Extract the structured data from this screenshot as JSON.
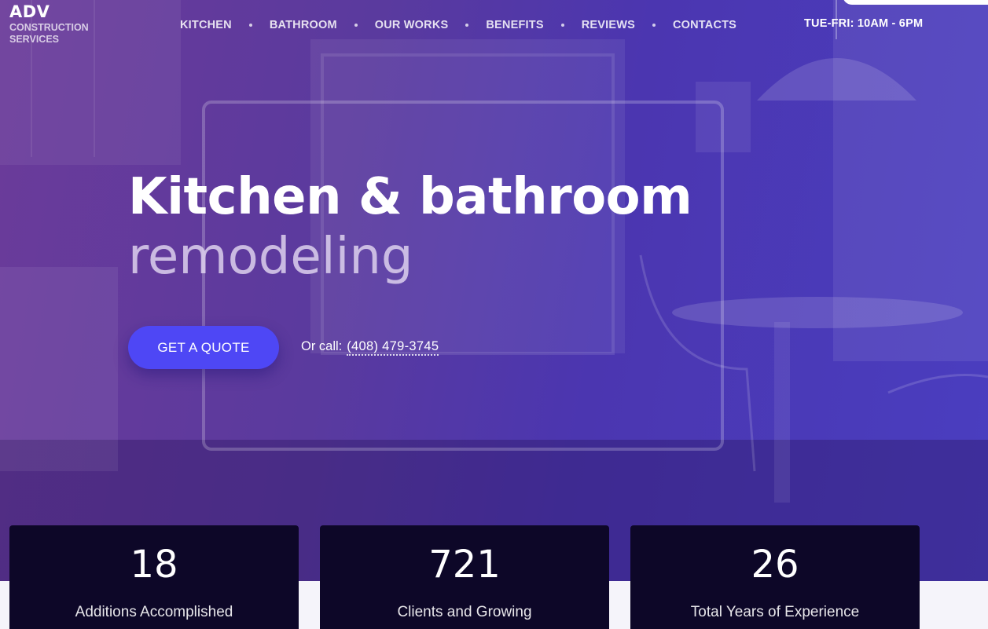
{
  "brand": {
    "name": "ADV",
    "tagline": "CONSTRUCTION SERVICES"
  },
  "nav": {
    "items": [
      {
        "label": "KITCHEN"
      },
      {
        "label": "BATHROOM"
      },
      {
        "label": "OUR WORKS"
      },
      {
        "label": "BENEFITS"
      },
      {
        "label": "REVIEWS"
      },
      {
        "label": "CONTACTS"
      }
    ]
  },
  "hours": "TUE-FRI: 10AM - 6PM",
  "hero": {
    "title": "Kitchen & bathroom",
    "subtitle": "remodeling",
    "cta_label": "GET A QUOTE",
    "call_label": "Or call:",
    "phone": "(408) 479-3745"
  },
  "stats": [
    {
      "value": "18",
      "label": "Additions Accomplished"
    },
    {
      "value": "721",
      "label": "Clients and Growing"
    },
    {
      "value": "26",
      "label": "Total Years of Experience"
    }
  ],
  "colors": {
    "accent": "#4e47f5",
    "stat_card": "#0d0728",
    "hero_overlay": "#5a3a9e"
  }
}
